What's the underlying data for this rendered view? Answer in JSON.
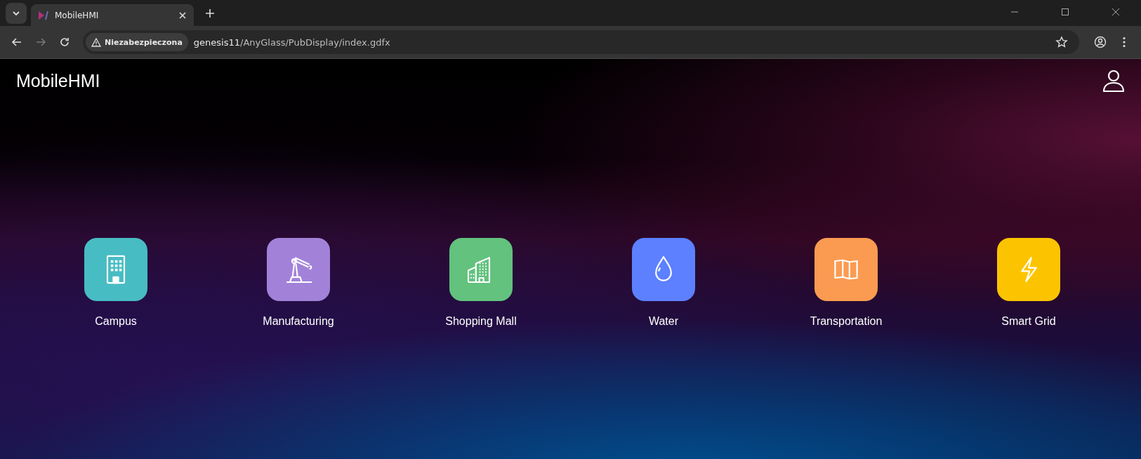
{
  "browser": {
    "tab_title": "MobileHMI",
    "security_label": "Niezabezpieczona",
    "url_host": "genesis11",
    "url_path": "/AnyGlass/PubDisplay/index.gdfx"
  },
  "app": {
    "title": "MobileHMI"
  },
  "tiles": [
    {
      "label": "Campus",
      "color": "#48bcc3"
    },
    {
      "label": "Manufacturing",
      "color": "#a282d9"
    },
    {
      "label": "Shopping Mall",
      "color": "#62c27e"
    },
    {
      "label": "Water",
      "color": "#5c80ff"
    },
    {
      "label": "Transportation",
      "color": "#fb9b52"
    },
    {
      "label": "Smart Grid",
      "color": "#fcc400"
    }
  ]
}
